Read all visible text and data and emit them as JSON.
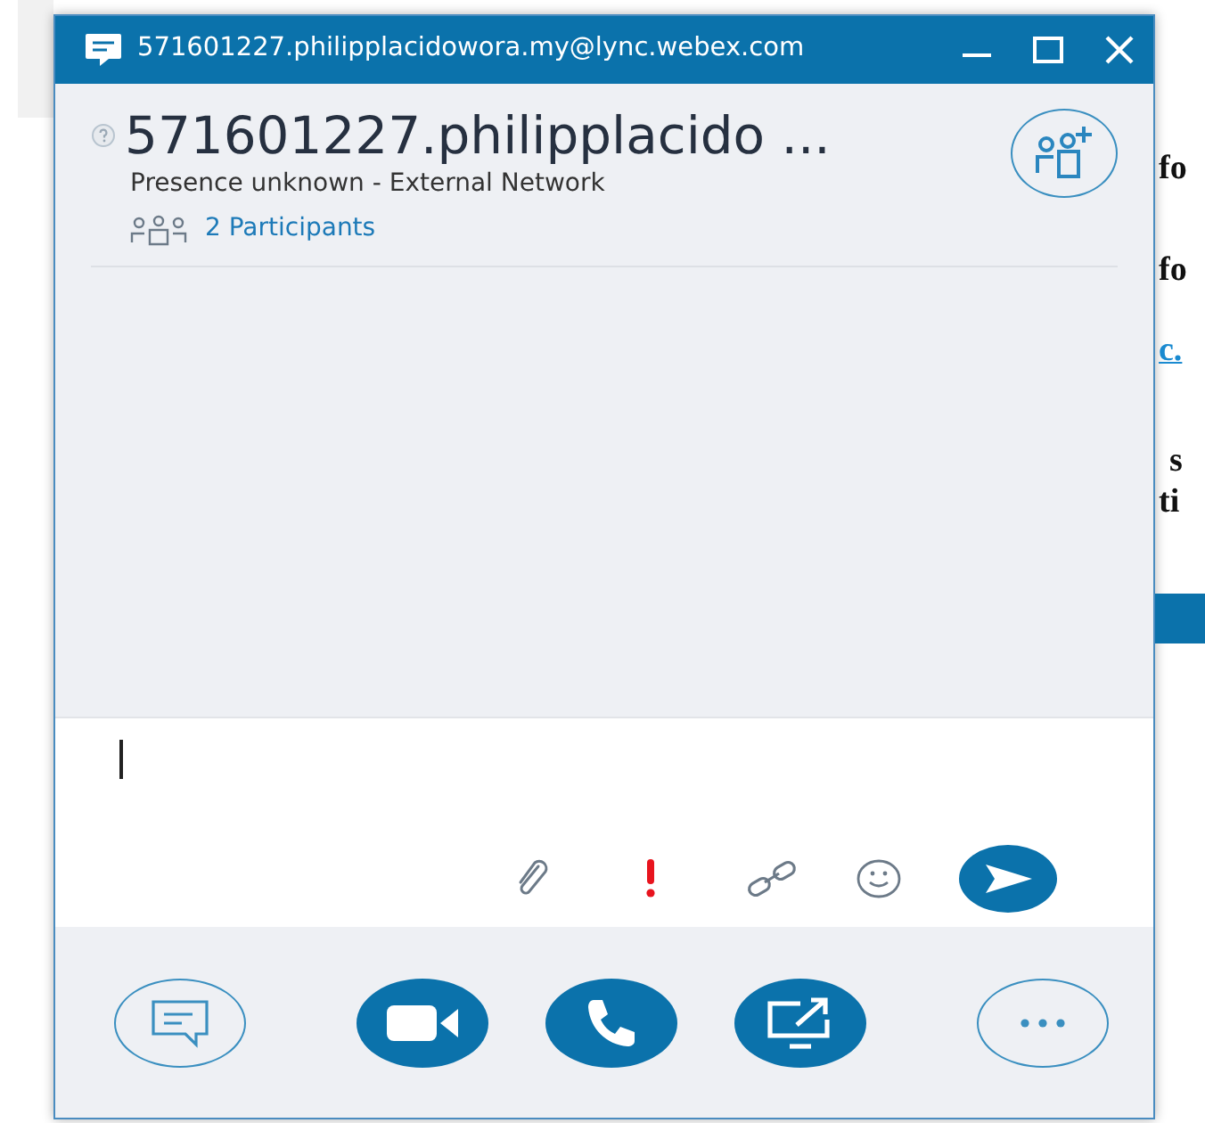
{
  "window": {
    "title": "571601227.philipplacidowora.my@lync.webex.com"
  },
  "contact": {
    "name": "571601227.philipplacido ...",
    "presence": "Presence unknown - External Network",
    "participants": "2 Participants"
  },
  "compose": {
    "tools": [
      {
        "kind": "attach"
      },
      {
        "kind": "priority"
      },
      {
        "kind": "link"
      },
      {
        "kind": "emoji"
      }
    ]
  },
  "actions": [
    {
      "kind": "chat"
    },
    {
      "kind": "video"
    },
    {
      "kind": "call"
    },
    {
      "kind": "share"
    },
    {
      "kind": "more"
    }
  ],
  "background": {
    "fragments": [
      {
        "text": "fo",
        "kind": "text"
      },
      {
        "text": "fo",
        "kind": "text"
      },
      {
        "text": "c.",
        "kind": "link"
      },
      {
        "text": "s",
        "kind": "text"
      },
      {
        "text": "ti",
        "kind": "text"
      }
    ]
  }
}
